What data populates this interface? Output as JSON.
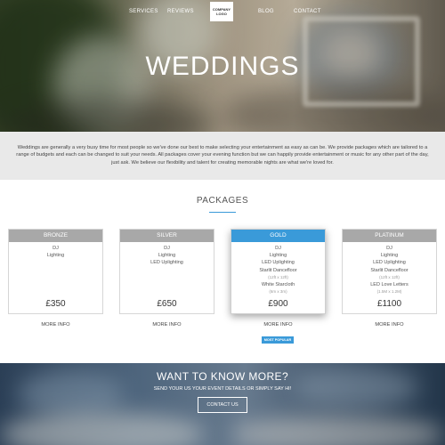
{
  "nav": {
    "links": [
      "SERVICES",
      "REVIEWS",
      "BLOG",
      "CONTACT"
    ],
    "logo_line1": "COMPANY",
    "logo_line2": "LOGO"
  },
  "hero": {
    "title": "WEDDINGS"
  },
  "intro": {
    "text": "Weddings are generally a very busy time for most people so we've done our best to make selecting your entertainment as easy as can be. We provide packages which are tailored to a range of budgets and each can be changed to suit your needs. All packages cover your evening function but we can happily provide entertainment or music for any other part of the day, just ask. We believe our flexibility and talent for creating memorable nights are what we're loved for."
  },
  "packages": {
    "title": "PACKAGES",
    "more_info_label": "MORE INFO",
    "badge": "MOST POPULAR",
    "items": [
      {
        "name": "BRONZE",
        "price": "£350",
        "features": [
          "DJ",
          "Lighting"
        ]
      },
      {
        "name": "SILVER",
        "price": "£650",
        "features": [
          "DJ",
          "Lighting",
          "LED Uplighting"
        ]
      },
      {
        "name": "GOLD",
        "price": "£900",
        "features": [
          "DJ",
          "Lighting",
          "LED Uplighting",
          "Starlit Dancefloor",
          "(12ft x 12ft)",
          "White Starcloth",
          "(6m x 3m)"
        ]
      },
      {
        "name": "PLATINUM",
        "price": "£1100",
        "features": [
          "DJ",
          "Lighting",
          "LED Uplighting",
          "Starlit Dancefloor",
          "(12ft x 12ft)",
          "LED Love Letters",
          "(1.5M x 1.2M)"
        ]
      }
    ]
  },
  "cta": {
    "title": "WANT TO KNOW MORE?",
    "subtitle": "SEND YOUR US YOUR EVENT DETAILS OR SIMPLY SAY HI!",
    "button": "CONTACT US"
  },
  "colors": {
    "accent": "#3a9ad9",
    "card_header": "#a8a8a8",
    "intro_bg": "#e9e9e9"
  }
}
